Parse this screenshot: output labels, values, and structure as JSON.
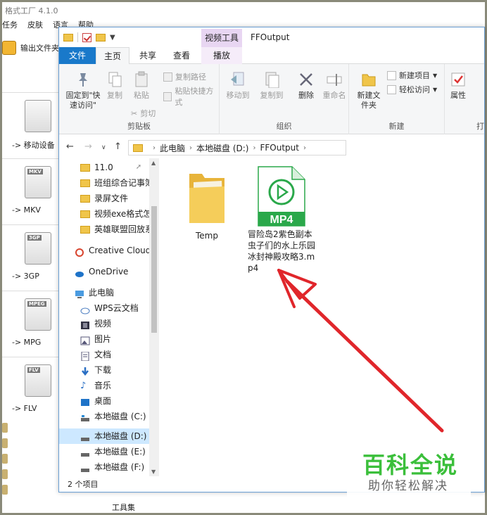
{
  "background_app": {
    "title": "格式工厂 4.1.0",
    "menu": [
      "任务",
      "皮肤",
      "语言",
      "帮助"
    ],
    "output_folder_label": "输出文件夹",
    "items": [
      {
        "label": "-> 移动设备",
        "icon": "mobile-device-icon",
        "tag": ""
      },
      {
        "label": "-> MKV",
        "icon": "mkv-file-icon",
        "tag": "MKV"
      },
      {
        "label": "-> 3GP",
        "icon": "3gp-file-icon",
        "tag": "3GP"
      },
      {
        "label": "-> MPG",
        "icon": "mpg-file-icon",
        "tag": "MPEG"
      },
      {
        "label": "-> FLV",
        "icon": "flv-file-icon",
        "tag": "FLV"
      }
    ],
    "toolbox_label": "工具集"
  },
  "explorer": {
    "window_title": "FFOutput",
    "context_tab_group": "视频工具",
    "tabs": {
      "file": "文件",
      "home": "主页",
      "share": "共享",
      "view": "查看",
      "play": "播放"
    },
    "ribbon": {
      "clipboard": {
        "group_label": "剪贴板",
        "pin_quick_access": "固定到\"快速访问\"",
        "copy": "复制",
        "paste": "粘贴",
        "copy_path": "复制路径",
        "paste_shortcut": "粘贴快捷方式",
        "cut": "剪切"
      },
      "organize": {
        "group_label": "组织",
        "move_to": "移动到",
        "copy_to": "复制到",
        "delete": "删除",
        "rename": "重命名"
      },
      "new": {
        "group_label": "新建",
        "new_folder": "新建文件夹",
        "new_item": "新建项目",
        "easy_access": "轻松访问"
      },
      "open": {
        "group_label": "打",
        "properties": "属性"
      }
    },
    "address": {
      "crumbs": [
        "此电脑",
        "本地磁盘 (D:)",
        "FFOutput"
      ]
    },
    "nav_pane": {
      "quick_access": [
        {
          "label": "11.0",
          "pinned": true
        },
        {
          "label": "班组综合记事簿"
        },
        {
          "label": "录屏文件"
        },
        {
          "label": "视频exe格式怎"
        },
        {
          "label": "英雄联盟回放系"
        }
      ],
      "creative_cloud": "Creative Cloud",
      "onedrive": "OneDrive",
      "this_pc": "此电脑",
      "pc_items": [
        {
          "label": "WPS云文档",
          "icon": "cloud-icon"
        },
        {
          "label": "视频",
          "icon": "video-folder-icon"
        },
        {
          "label": "图片",
          "icon": "pictures-folder-icon"
        },
        {
          "label": "文档",
          "icon": "documents-folder-icon"
        },
        {
          "label": "下载",
          "icon": "download-folder-icon"
        },
        {
          "label": "音乐",
          "icon": "music-folder-icon"
        },
        {
          "label": "桌面",
          "icon": "desktop-folder-icon"
        },
        {
          "label": "本地磁盘 (C:)",
          "icon": "drive-c-icon"
        },
        {
          "label": "本地磁盘 (D:)",
          "icon": "drive-d-icon",
          "selected": true
        },
        {
          "label": "本地磁盘 (E:)",
          "icon": "drive-e-icon"
        },
        {
          "label": "本地磁盘 (F:)",
          "icon": "drive-f-icon"
        }
      ]
    },
    "files": [
      {
        "name": "Temp",
        "type": "folder"
      },
      {
        "name": "冒险岛2紫色副本虫子们的水上乐园冰封神殿攻略3.mp4",
        "type": "mp4",
        "badge": "MP4"
      }
    ],
    "status": "2 个项目"
  },
  "watermark": {
    "main": "百科全说",
    "sub": "助你轻松解决",
    "color": "#3bbf3b"
  },
  "colors": {
    "accent": "#1979ca",
    "arrow": "#e0262b",
    "selection": "#cde8ff",
    "context_tab": "#e8d6f2"
  }
}
